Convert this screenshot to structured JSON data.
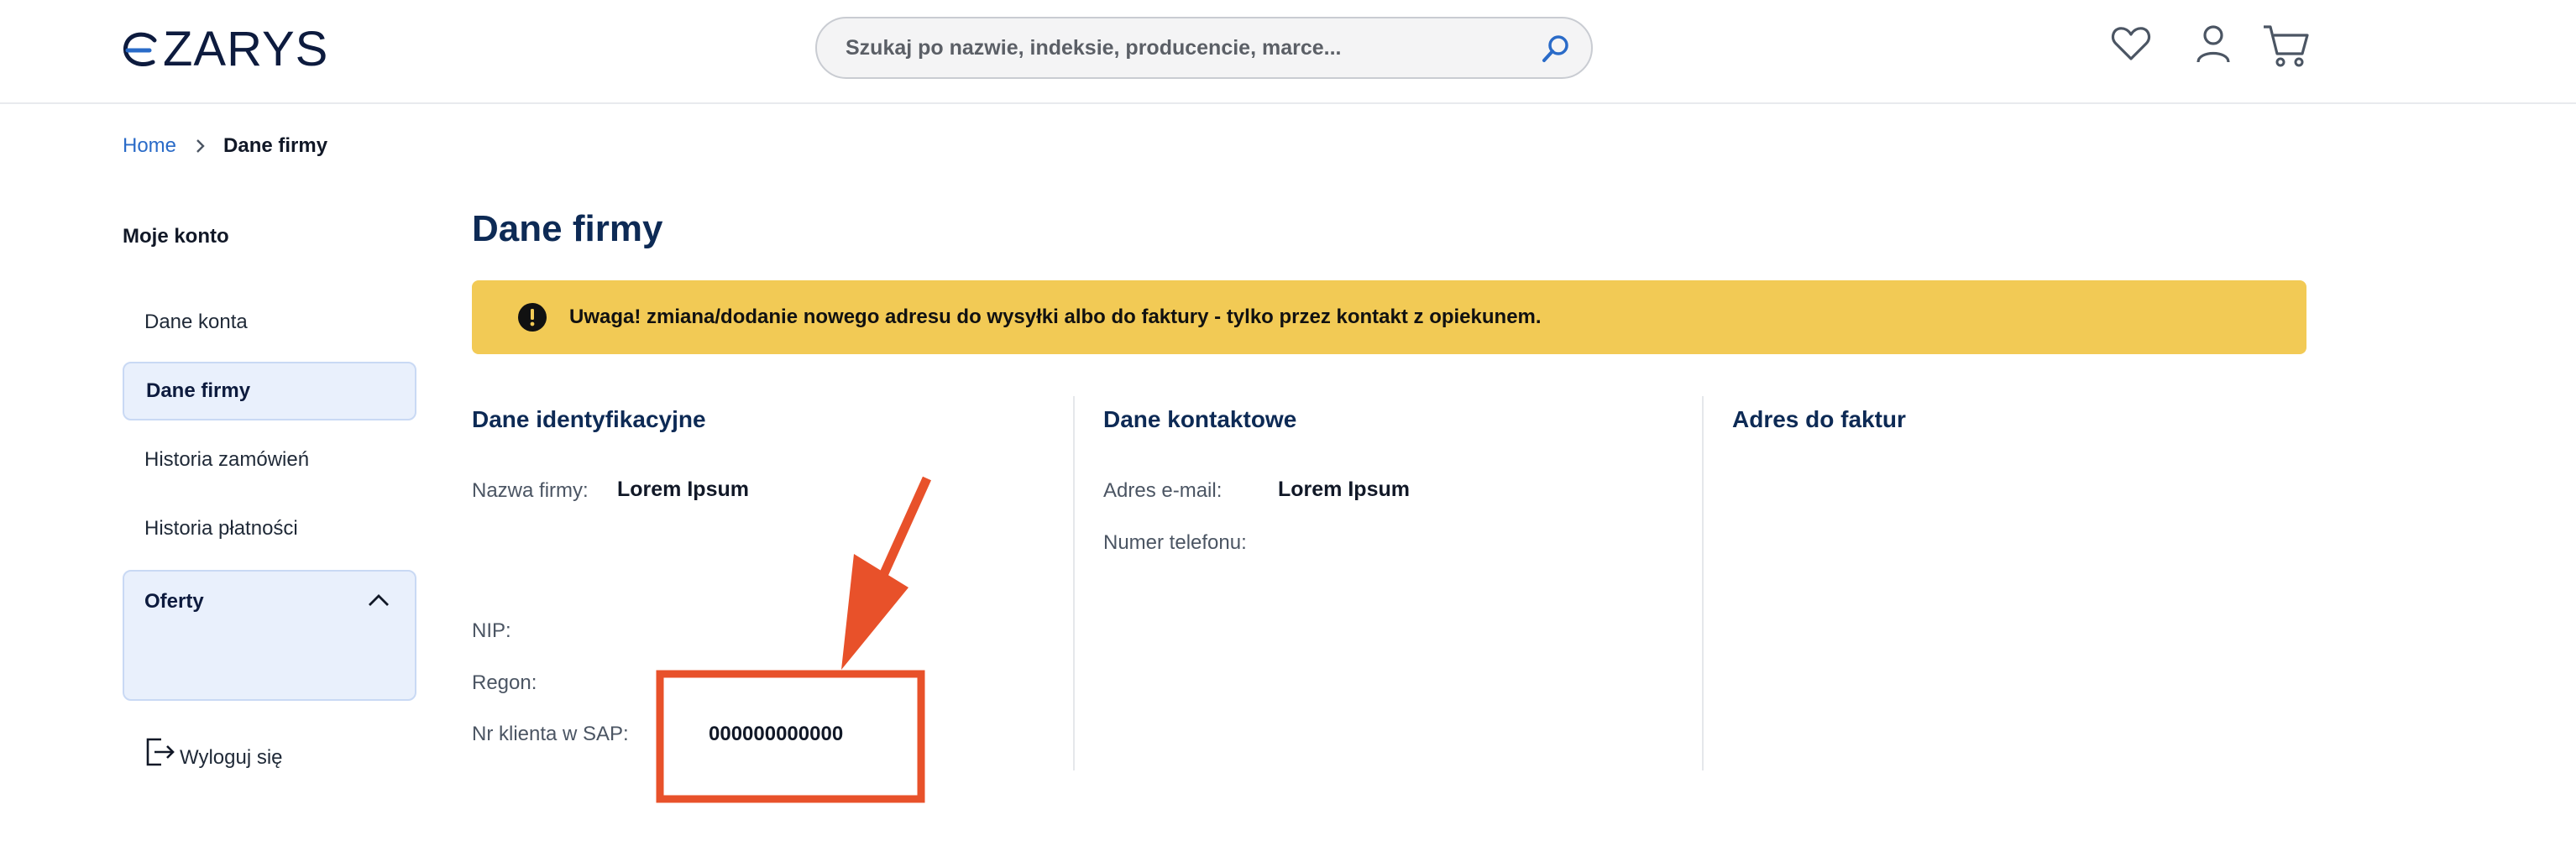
{
  "header": {
    "logo_text": "ZARYS",
    "search": {
      "placeholder": "Szukaj po nazwie, indeksie, producencie, marce..."
    },
    "icons": [
      "heart-icon",
      "user-icon",
      "cart-icon"
    ]
  },
  "breadcrumb": {
    "home": "Home",
    "current": "Dane firmy"
  },
  "sidebar": {
    "title": "Moje konto",
    "items": [
      {
        "label": "Dane konta",
        "active": false
      },
      {
        "label": "Dane firmy",
        "active": true
      },
      {
        "label": "Historia zamówień",
        "active": false
      },
      {
        "label": "Historia płatności",
        "active": false
      }
    ],
    "offers": {
      "label": "Oferty",
      "expanded": true
    },
    "logout": "Wyloguj się"
  },
  "main": {
    "title": "Dane firmy",
    "alert": "Uwaga! zmiana/dodanie nowego adresu do wysyłki albo do faktury - tylko przez kontakt z opiekunem.",
    "identification": {
      "title": "Dane identyfikacyjne",
      "company_name_label": "Nazwa firmy:",
      "company_name_value": "Lorem Ipsum",
      "nip_label": "NIP:",
      "regon_label": "Regon:",
      "sap_label": "Nr klienta w SAP:",
      "sap_value": "000000000000"
    },
    "contact": {
      "title": "Dane kontaktowe",
      "email_label": "Adres e-mail:",
      "email_value": "Lorem Ipsum",
      "phone_label": "Numer telefonu:"
    },
    "invoice_address": {
      "title": "Adres do faktur"
    }
  },
  "colors": {
    "accent_blue": "#2a6bc8",
    "heading_navy": "#0d2a55",
    "alert_yellow": "#f2ca55",
    "active_bg": "#e9f0fc",
    "annotation_orange": "#e8512a"
  }
}
